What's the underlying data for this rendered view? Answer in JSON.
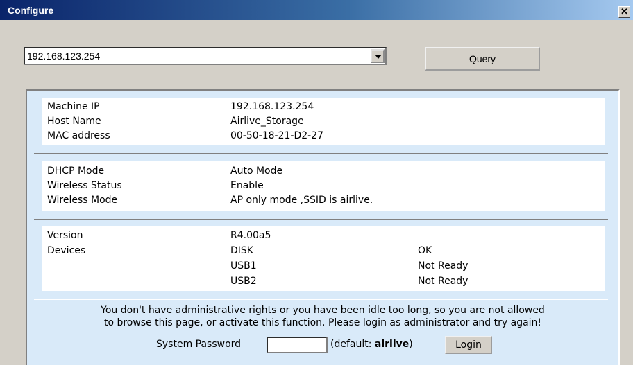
{
  "window": {
    "title": "Configure",
    "close_label": "✕"
  },
  "toolbar": {
    "ip_select_value": "192.168.123.254",
    "query_label": "Query"
  },
  "network": {
    "rows": [
      {
        "label": "Machine IP",
        "value": "192.168.123.254"
      },
      {
        "label": "Host Name",
        "value": "Airlive_Storage"
      },
      {
        "label": "MAC address",
        "value": "00-50-18-21-D2-27"
      }
    ]
  },
  "wireless": {
    "rows": [
      {
        "label": "DHCP Mode",
        "value": "Auto Mode"
      },
      {
        "label": "Wireless Status",
        "value": "Enable"
      },
      {
        "label": "Wireless Mode",
        "value": "AP only mode ,SSID is airlive."
      }
    ]
  },
  "system": {
    "version_label": "Version",
    "version_value": "R4.00a5",
    "devices_label": "Devices",
    "devices": [
      {
        "name": "DISK",
        "status": "OK"
      },
      {
        "name": "USB1",
        "status": "Not Ready"
      },
      {
        "name": "USB2",
        "status": "Not Ready"
      }
    ]
  },
  "login": {
    "notice_line1": "You don't have administrative rights or you have been idle too long, so you are not allowed",
    "notice_line2": "to browse this page, or activate this function. Please login as administrator and try again!",
    "password_label": "System Password",
    "password_value": "",
    "default_prefix": "(default: ",
    "default_password": "airlive",
    "default_suffix": ")",
    "login_label": "Login"
  },
  "colors": {
    "title_bar": "#0a246a",
    "dialog_background": "#d4d0c8",
    "panel_background": "#d9eaf9",
    "section_background": "#ffffff"
  }
}
